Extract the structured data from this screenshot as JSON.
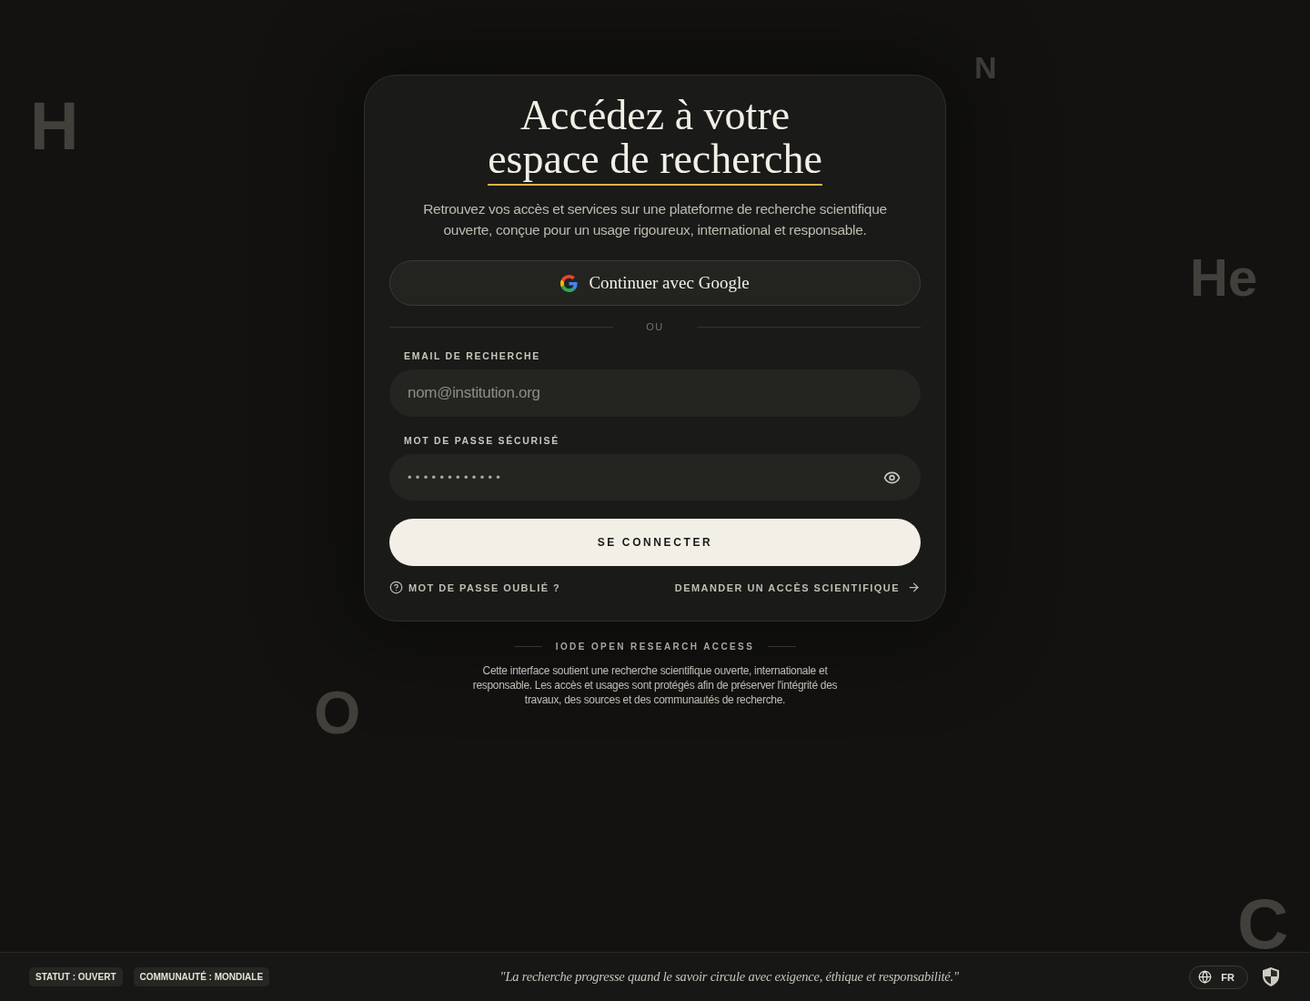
{
  "background_symbols": [
    "H",
    "N",
    "He",
    "O",
    "C"
  ],
  "login_card": {
    "title": {
      "text": "Accédez à votre",
      "highlighted": "espace de recherche"
    },
    "subtitle": "Retrouvez vos accès et services sur une plateforme de recherche scientifique ouverte, conçue pour un usage rigoureux, international et responsable.",
    "google_button": {
      "label": "Continuer avec Google"
    },
    "divider": "OU",
    "fields": [
      {
        "kind": "email",
        "label": "EMAIL DE RECHERCHE",
        "placeholder": "nom@institution.org"
      },
      {
        "kind": "password",
        "label": "MOT DE PASSE SÉCURISÉ",
        "value": "••••••••••••"
      }
    ],
    "submit_button": {
      "label": "SE CONNECTER"
    },
    "links": [
      {
        "kind": "help",
        "label": "MOT DE PASSE OUBLIÉ ?"
      },
      {
        "kind": "forward",
        "label": "DEMANDER UN ACCÈS SCIENTIFIQUE"
      }
    ]
  },
  "about": {
    "title": "IODE OPEN RESEARCH ACCESS",
    "text": "Cette interface soutient une recherche scientifique ouverte, internationale et responsable. Les accès et usages sont protégés afin de préserver l'intégrité des travaux, des sources et des communautés de recherche."
  },
  "footer": {
    "tags": [
      "STATUT : OUVERT",
      "COMMUNAUTÉ : MONDIALE"
    ],
    "quote": "\"La recherche progresse quand le savoir circule avec exigence, éthique et responsabilité.\"",
    "language": "FR"
  }
}
